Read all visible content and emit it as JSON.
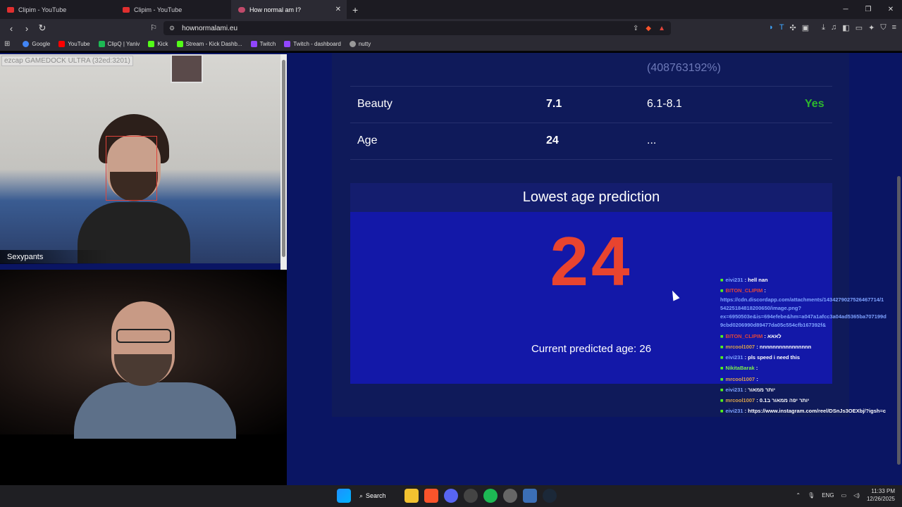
{
  "browser": {
    "tabs": [
      {
        "label": "Clipim - YouTube",
        "active": false
      },
      {
        "label": "Clipim - YouTube",
        "active": false
      },
      {
        "label": "How normal am I?",
        "active": true
      }
    ],
    "url": "hownormalami.eu",
    "bookmarks": [
      {
        "label": "Google",
        "color": "#4285f4"
      },
      {
        "label": "YouTube",
        "color": "#ff0000"
      },
      {
        "label": "ClipQ | Yaniv",
        "color": "#1db954"
      },
      {
        "label": "Kick",
        "color": "#53fc18"
      },
      {
        "label": "Stream - Kick Dashb...",
        "color": "#53fc18"
      },
      {
        "label": "Twitch",
        "color": "#9146ff"
      },
      {
        "label": "Twitch - dashboard",
        "color": "#9146ff"
      },
      {
        "label": "nutty",
        "color": "#999999"
      }
    ]
  },
  "results": {
    "percent_text": "(408763192%)",
    "rows": [
      {
        "label": "Beauty",
        "value": "7.1",
        "range": "6.1-8.1",
        "status": "Yes"
      },
      {
        "label": "Age",
        "value": "24",
        "range": "...",
        "status": ""
      }
    ],
    "prediction": {
      "title": "Lowest age prediction",
      "value": "24",
      "current_label": "Current predicted age: 26"
    }
  },
  "webcam1": {
    "overlay_text": "ezcap GAMEDOCK ULTRA (32ed:3201)",
    "name_label": "Sexypants"
  },
  "chat": [
    {
      "user": "eivi231",
      "text": ": hell nan",
      "user_color": "blue"
    },
    {
      "user": "BITON_CLIPIM",
      "text": ":",
      "user_color": "red"
    },
    {
      "user": "",
      "text": "https://cdn.discordapp.com/attachments/1434279027526467714/1",
      "user_color": "blue"
    },
    {
      "user": "",
      "text": "54225184818200650/image.png?",
      "user_color": "blue"
    },
    {
      "user": "",
      "text": "ex=6950503e&is=694efebe&hm=a047a1afcc3a04ad5365ba707199d",
      "user_color": "blue"
    },
    {
      "user": "",
      "text": "9cbd0206990d89477da05c554cfb167392f&",
      "user_color": "blue"
    },
    {
      "user": "BITON_CLIPIM",
      "text": ": לאאא",
      "user_color": "red"
    },
    {
      "user": "mrcool1007",
      "text": ": nnnnnnnnnnnnnnnn",
      "user_color": "gold"
    },
    {
      "user": "eivi231",
      "text": ": pls speed i need this",
      "user_color": "blue"
    },
    {
      "user": "NikitaBarak",
      "text": ":",
      "user_color": "green"
    },
    {
      "user": "mrcool1007",
      "text": ":",
      "user_color": "gold"
    },
    {
      "user": "eivi231",
      "text": ": יותר ממאור",
      "user_color": "blue"
    },
    {
      "user": "mrcool1007",
      "text": ": יותר יפה ממאור ב0.1",
      "user_color": "gold"
    },
    {
      "user": "eivi231",
      "text": ": https://www.instagram.com/reel/DSnJs3OEXbj/?igsh=c",
      "user_color": "blue"
    }
  ],
  "taskbar": {
    "search_label": "Search",
    "lang": "ENG",
    "time": "11:33 PM",
    "date": "12/26/2025"
  }
}
